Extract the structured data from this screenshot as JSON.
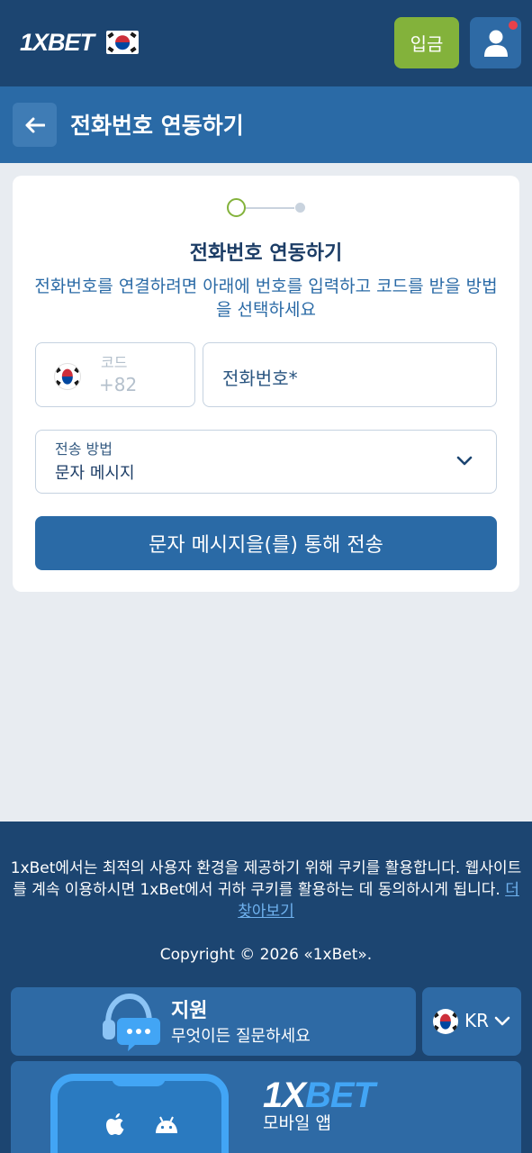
{
  "header": {
    "logo_1x": "1X",
    "logo_bet": "BET",
    "deposit_label": "입금"
  },
  "subheader": {
    "title": "전화번호 연동하기"
  },
  "form": {
    "title": "전화번호 연동하기",
    "description": "전화번호를 연결하려면 아래에 번호를 입력하고 코드를 받을 방법을 선택하세요",
    "code_label": "코드",
    "code_value": "+82",
    "phone_placeholder": "전화번호*",
    "method_label": "전송 방법",
    "method_value": "문자 메시지",
    "submit_label": "문자 메시지을(를) 통해 전송",
    "step_current": 1,
    "step_total": 2
  },
  "footer": {
    "cookie_text": "1xBet에서는 최적의 사용자 환경을 제공하기 위해 쿠키를 활용합니다. 웹사이트를 계속 이용하시면 1xBet에서 귀하 쿠키를 활용하는 데 동의하시게 됩니다.",
    "cookie_link": "더 찾아보기",
    "copyright": "Copyright © 2026 «1xBet».",
    "support_title": "지원",
    "support_subtitle": "무엇이든 질문하세요",
    "language_code": "KR",
    "app_logo_1x": "1X",
    "app_logo_bet": "BET",
    "app_label": "모바일 앱"
  },
  "colors": {
    "header_bg": "#1c4571",
    "subheader_bg": "#2a6aa6",
    "deposit_green": "#83b23b",
    "primary_button": "#2a6aa6",
    "page_bg": "#e8ecf1"
  },
  "icons": [
    "flag-kr-icon",
    "user-icon",
    "arrow-left-icon",
    "chevron-down-icon",
    "headset-icon",
    "chat-bubble-icon",
    "apple-icon",
    "android-icon"
  ]
}
